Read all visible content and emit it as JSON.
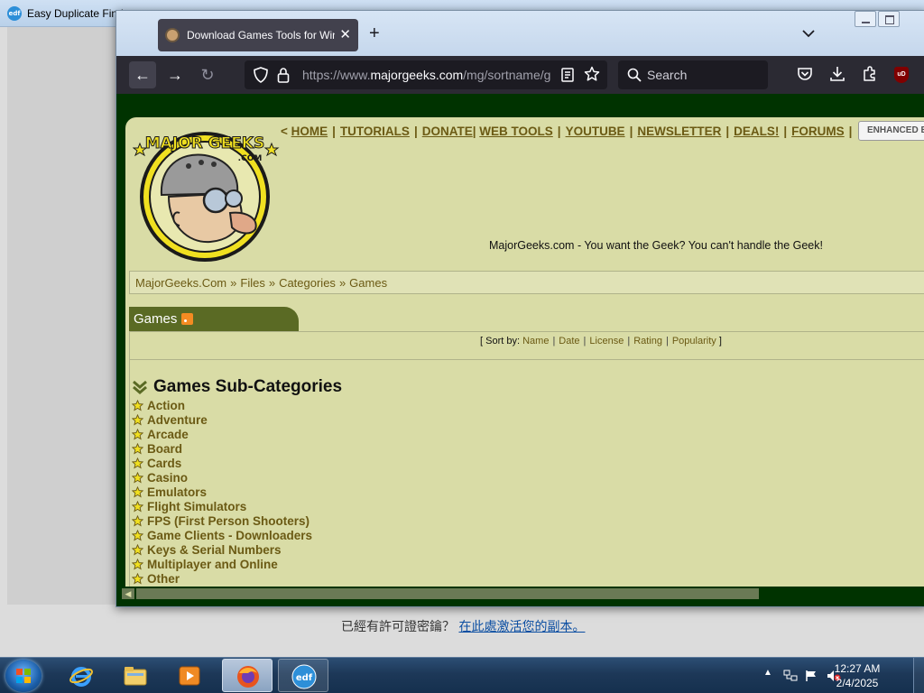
{
  "background_app": {
    "title": "Easy Duplicate Find",
    "icon": "edf-app-icon",
    "activation_text": "已經有許可證密鑰？",
    "activation_link": "在此處激活您的副本。"
  },
  "browser": {
    "tab": {
      "title": "Download Games Tools for Win",
      "favicon": "majorgeeks-favicon"
    },
    "url": {
      "prefix": "https://www.",
      "domain": "majorgeeks.com",
      "path": "/mg/sortname/g"
    },
    "search_placeholder": "Search",
    "ublock_label": "uD"
  },
  "site": {
    "logo_text": "MAJOR GEEKS",
    "logo_sub": ".COM",
    "nav": {
      "prefix": "<",
      "items": [
        "HOME",
        "TUTORIALS",
        "DONATE",
        "WEB TOOLS",
        "YOUTUBE",
        "NEWSLETTER",
        "DEALS!",
        "FORUMS"
      ]
    },
    "enhanced_button": "ENHANCED BY",
    "tagline": "MajorGeeks.com - You want the Geek? You can't handle the Geek!",
    "breadcrumb": [
      "MajorGeeks.Com",
      "Files",
      "Categories",
      "Games"
    ],
    "breadcrumb_sep": "»",
    "category_tab": "Games",
    "sort": {
      "open": "[ Sort by:",
      "options": [
        "Name",
        "Date",
        "License",
        "Rating",
        "Popularity"
      ],
      "close": "]"
    },
    "subcategories_heading": "Games Sub-Categories",
    "subcategories": [
      "Action",
      "Adventure",
      "Arcade",
      "Board",
      "Cards",
      "Casino",
      "Emulators",
      "Flight Simulators",
      "FPS (First Person Shooters)",
      "Game Clients - Downloaders",
      "Keys & Serial Numbers",
      "Multiplayer and Online",
      "Other"
    ]
  },
  "taskbar": {
    "apps": [
      "internet-explorer",
      "windows-explorer",
      "media-player",
      "firefox",
      "easy-duplicate-finder"
    ],
    "edf_label": "edf",
    "clock": {
      "time": "12:27 AM",
      "date": "2/4/2025"
    }
  },
  "colors": {
    "site_bg": "#d9dca6",
    "site_outer": "#003300",
    "link": "#6b5a14",
    "firefox_toolbar": "#2b2a33"
  }
}
